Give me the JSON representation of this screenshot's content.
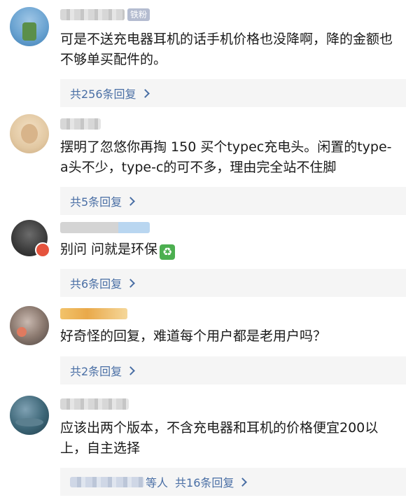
{
  "comments": [
    {
      "fan_tag": "铁粉",
      "text": "可是不送充电器耳机的话手机价格也没降啊，降的金额也不够单买配件的。",
      "replies": "共256条回复"
    },
    {
      "text": "摆明了忽悠你再掏 150 买个typec充电头。闲置的type-a头不少，type-c的可不多，理由完全站不住脚",
      "replies": "共5条回复"
    },
    {
      "text": "别问 问就是环保",
      "emoji": "♻",
      "replies": "共6条回复"
    },
    {
      "text": "好奇怪的回复，难道每个用户都是老用户吗？",
      "replies": "共2条回复"
    },
    {
      "text": "应该出两个版本，不含充电器和耳机的价格便宜200以上，自主选择",
      "replier_suffix": "等人",
      "replies": "共16条回复"
    }
  ],
  "colors": {
    "link": "#4a6fa5",
    "reply_bg": "#f5f5f5",
    "text": "#1a1a1a"
  }
}
